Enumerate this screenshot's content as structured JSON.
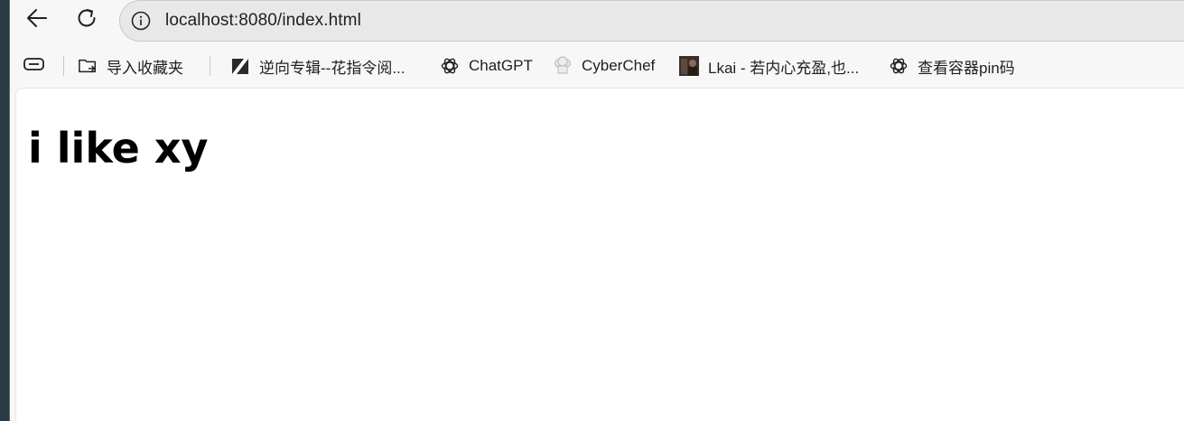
{
  "toolbar": {
    "url": "localhost:8080/index.html"
  },
  "bookmarks": [
    {
      "label": "导入收藏夹",
      "icon": "import-favorites-icon"
    },
    {
      "label": "逆向专辑--花指令阅...",
      "icon": "site-logo-icon"
    },
    {
      "label": "ChatGPT",
      "icon": "openai-icon"
    },
    {
      "label": "CyberChef",
      "icon": "chef-hat-icon"
    },
    {
      "label": "Lkai - 若内心充盈,也...",
      "icon": "thumbnail-icon"
    },
    {
      "label": "查看容器pin码",
      "icon": "openai-icon"
    }
  ],
  "page": {
    "heading": "i like xy"
  }
}
